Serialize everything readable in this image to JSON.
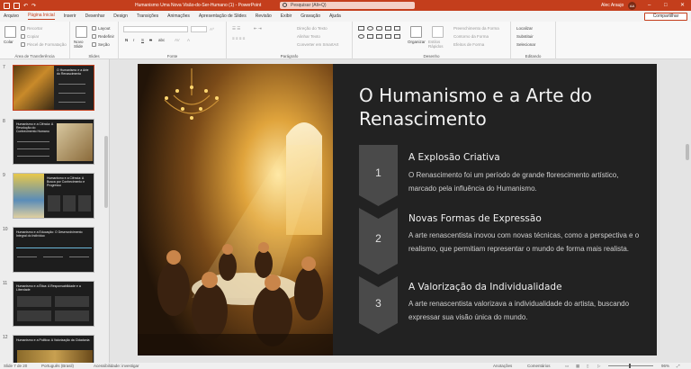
{
  "titlebar": {
    "title": "Humanismo Uma Nova Visão-do-Ser-Humano (1) - PowerPoint",
    "search_placeholder": "Pesquisar (Alt+Q)",
    "user": "Alec Araujo",
    "avatar": "AA",
    "minimize": "–",
    "maximize": "□",
    "close": "✕"
  },
  "menu": {
    "tabs": [
      "Arquivo",
      "Página Inicial",
      "Inserir",
      "Desenhar",
      "Design",
      "Transições",
      "Animações",
      "Apresentação de Slides",
      "Revisão",
      "Exibir",
      "Gravação",
      "Ajuda"
    ],
    "active_index": 1,
    "share": "Compartilhar"
  },
  "ribbon": {
    "clipboard": {
      "paste": "Colar",
      "cut": "Recortar",
      "copy": "Copiar",
      "format_painter": "Pincel de Formatação",
      "label": "Área de Transferência"
    },
    "slides": {
      "new_slide": "Novo Slide",
      "layout": "Layout",
      "reset": "Redefinir",
      "section": "Seção",
      "label": "Slides"
    },
    "font": {
      "label": "Fonte",
      "bold": "N",
      "italic": "I",
      "underline": "S",
      "strike": "S",
      "shadow": "abc"
    },
    "paragraph": {
      "label": "Parágrafo",
      "direction": "Direção do Texto",
      "align": "Alinhar Texto",
      "smartart": "Converter em SmartArt"
    },
    "drawing": {
      "label": "Desenho",
      "organize": "Organizar",
      "quick_styles": "Estilos Rápidos",
      "fill": "Preenchimento da Forma",
      "outline": "Contorno da Forma",
      "effects": "Efeitos de Forma"
    },
    "editing": {
      "label": "Editando",
      "find": "Localizar",
      "replace": "Substituir",
      "select": "Selecionar"
    }
  },
  "slides_panel": [
    {
      "num": "7",
      "title": "O Humanismo e a Arte do Renascimento",
      "active": true
    },
    {
      "num": "8",
      "title": "Humanismo e a Ciência: A Revolução do Conhecimento Humano",
      "active": false
    },
    {
      "num": "9",
      "title": "Humanismo e a Ciência: A Busca por Conhecimento e Progresso",
      "active": false
    },
    {
      "num": "10",
      "title": "Humanismo e a Educação: O Desenvolvimento Integral do Indivíduo",
      "active": false
    },
    {
      "num": "11",
      "title": "Humanismo e a Ética: A Responsabilidade e a Liberdade",
      "active": false
    },
    {
      "num": "12",
      "title": "Humanismo e a Política: A Valorização da Cidadania",
      "active": false
    }
  ],
  "slide": {
    "title": "O Humanismo e a Arte do Renascimento",
    "steps": [
      {
        "num": "1",
        "heading": "A Explosão Criativa",
        "body": "O Renascimento foi um período de grande florescimento artístico, marcado pela influência do Humanismo."
      },
      {
        "num": "2",
        "heading": "Novas Formas de Expressão",
        "body": "A arte renascentista inovou com novas técnicas, como a perspectiva e o realismo, que permitiam representar o mundo de forma mais realista."
      },
      {
        "num": "3",
        "heading": "A Valorização da Individualidade",
        "body": "A arte renascentista valorizava a individualidade do artista, buscando expressar sua visão única do mundo."
      }
    ]
  },
  "status": {
    "slide_of": "Slide 7 de 20",
    "language": "Português (Brasil)",
    "accessibility": "Acessibilidade: investigar",
    "notes": "Anotações",
    "comments": "Comentários",
    "zoom": "96%"
  },
  "colors": {
    "accent": "#c43e1c",
    "slide_bg": "#222222",
    "chevron": "#4a4a4a"
  }
}
